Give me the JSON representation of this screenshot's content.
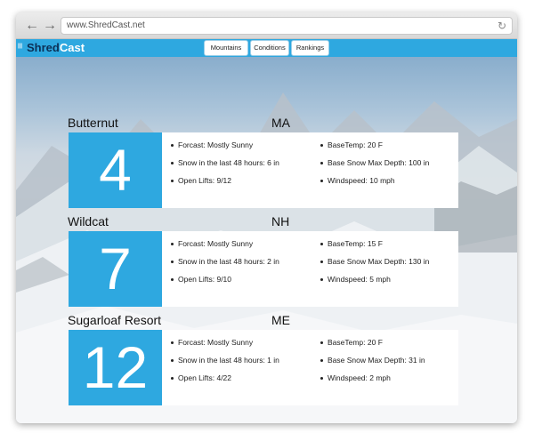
{
  "browser": {
    "url": "www.ShredCast.net",
    "back_icon": "back-arrow-icon",
    "forward_icon": "forward-arrow-icon",
    "reload_icon": "reload-icon"
  },
  "site": {
    "logo_mark": "|||",
    "logo_shred": "Shred",
    "logo_cast": "Cast",
    "accent_color": "#2ea8e0"
  },
  "nav": {
    "mountains": "Mountains",
    "conditions": "Conditions",
    "rankings": "Rankings"
  },
  "resorts": [
    {
      "name": "Butternut",
      "state": "MA",
      "score": "4",
      "forecast": "Forcast: Mostly Sunny",
      "snow48": "Snow in the last 48 hours: 6 in",
      "lifts": "Open Lifts: 9/12",
      "base_temp": "BaseTemp: 20 F",
      "base_depth": "Base Snow Max Depth: 100 in",
      "windspeed": "Windspeed: 10 mph"
    },
    {
      "name": "Wildcat",
      "state": "NH",
      "score": "7",
      "forecast": "Forcast: Mostly Sunny",
      "snow48": "Snow in the last 48 hours: 2 in",
      "lifts": "Open Lifts: 9/10",
      "base_temp": "BaseTemp: 15 F",
      "base_depth": "Base Snow Max Depth: 130 in",
      "windspeed": "Windspeed: 5 mph"
    },
    {
      "name": "Sugarloaf Resort",
      "state": "ME",
      "score": "12",
      "forecast": "Forcast: Mostly Sunny",
      "snow48": "Snow in the last 48 hours: 1 in",
      "lifts": "Open Lifts: 4/22",
      "base_temp": "BaseTemp: 20 F",
      "base_depth": "Base Snow Max Depth: 31 in",
      "windspeed": "Windspeed: 2 mph"
    }
  ]
}
